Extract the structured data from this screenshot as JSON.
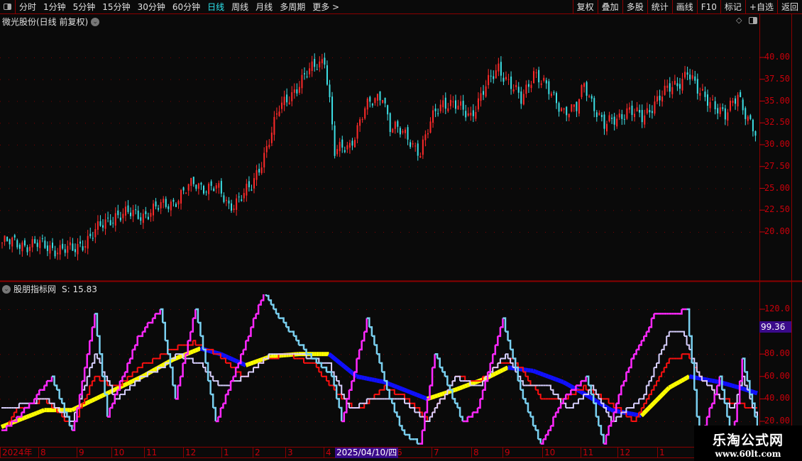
{
  "toolbar": {
    "periods": [
      "分时",
      "1分钟",
      "5分钟",
      "15分钟",
      "30分钟",
      "60分钟",
      "日线",
      "周线",
      "月线",
      "多周期",
      "更多 >"
    ],
    "active_index": 6,
    "right_buttons": [
      "复权",
      "叠加",
      "多股",
      "统计",
      "画线",
      "F10",
      "标记",
      "+自选",
      "返回"
    ]
  },
  "main_title": "微光股份(日线 前复权)",
  "indicator_title": "股朋指标网",
  "indicator_value": "S: 15.83",
  "price_axis": [
    "40.00",
    "37.50",
    "35.00",
    "32.50",
    "30.00",
    "27.50",
    "25.00",
    "22.50",
    "20.00"
  ],
  "indicator_axis": [
    "120.0",
    "80.00",
    "60.00",
    "40.00",
    "20.00"
  ],
  "crosshair_value": "99.36",
  "date_labels": [
    "2024年",
    "8",
    "9",
    "10",
    "11",
    "12",
    "1",
    "2",
    "3",
    "4",
    "6",
    "7",
    "8",
    "9",
    "10",
    "11",
    "12",
    "1"
  ],
  "selected_date": "2025/04/10/四",
  "watermark": {
    "title": "乐淘公式网",
    "url": "www.60lt.com"
  },
  "colors": {
    "up": "#ff2a2a",
    "down": "#3de0e6",
    "magenta": "#ff28ff",
    "cyan": "#7ad0f0",
    "lavender": "#d8d0ff",
    "red": "#ff1010",
    "yellow": "#ffff00",
    "blue": "#1010ff"
  },
  "chart_data": {
    "type": "candlestick+indicator",
    "bars": 300,
    "price_path": [
      [
        0,
        18.8
      ],
      [
        14,
        18.5
      ],
      [
        28,
        17.8
      ],
      [
        37,
        20
      ],
      [
        45,
        22
      ],
      [
        56,
        22
      ],
      [
        68,
        23.5
      ],
      [
        76,
        25.5
      ],
      [
        85,
        25
      ],
      [
        90,
        23
      ],
      [
        99,
        25
      ],
      [
        104,
        29
      ],
      [
        110,
        34
      ],
      [
        115,
        36
      ],
      [
        124,
        39
      ],
      [
        128,
        40
      ],
      [
        130,
        35
      ],
      [
        132,
        29
      ],
      [
        138,
        30
      ],
      [
        144,
        34
      ],
      [
        151,
        36
      ],
      [
        154,
        32
      ],
      [
        161,
        31
      ],
      [
        166,
        29
      ],
      [
        172,
        34
      ],
      [
        175,
        35
      ],
      [
        186,
        33.5
      ],
      [
        197,
        39
      ],
      [
        206,
        35
      ],
      [
        211,
        38.5
      ],
      [
        217,
        36
      ],
      [
        223,
        34
      ],
      [
        228,
        34
      ],
      [
        231,
        37
      ],
      [
        239,
        32
      ],
      [
        248,
        34
      ],
      [
        254,
        33
      ],
      [
        259,
        35
      ],
      [
        268,
        37
      ],
      [
        272,
        38.5
      ],
      [
        276,
        36
      ],
      [
        282,
        35
      ],
      [
        287,
        33
      ],
      [
        292,
        36
      ],
      [
        296,
        33
      ],
      [
        299,
        31
      ]
    ],
    "oscillator": [
      [
        0,
        10
      ],
      [
        11,
        35
      ],
      [
        20,
        60
      ],
      [
        28,
        10
      ],
      [
        37,
        115
      ],
      [
        42,
        25
      ],
      [
        54,
        95
      ],
      [
        63,
        120
      ],
      [
        69,
        40
      ],
      [
        77,
        120
      ],
      [
        85,
        20
      ],
      [
        92,
        60
      ],
      [
        104,
        135
      ],
      [
        111,
        110
      ],
      [
        121,
        80
      ],
      [
        131,
        60
      ],
      [
        135,
        20
      ],
      [
        145,
        110
      ],
      [
        154,
        40
      ],
      [
        159,
        10
      ],
      [
        166,
        0
      ],
      [
        172,
        80
      ],
      [
        183,
        20
      ],
      [
        189,
        30
      ],
      [
        199,
        110
      ],
      [
        207,
        40
      ],
      [
        214,
        0
      ],
      [
        223,
        40
      ],
      [
        232,
        60
      ],
      [
        239,
        0
      ],
      [
        248,
        65
      ],
      [
        259,
        115
      ],
      [
        266,
        115
      ],
      [
        272,
        120
      ],
      [
        277,
        0
      ],
      [
        285,
        60
      ],
      [
        290,
        0
      ],
      [
        294,
        75
      ],
      [
        300,
        15
      ]
    ],
    "red_line": [
      [
        0,
        10
      ],
      [
        6,
        30
      ],
      [
        17,
        40
      ],
      [
        28,
        15
      ],
      [
        37,
        60
      ],
      [
        45,
        50
      ],
      [
        56,
        70
      ],
      [
        68,
        85
      ],
      [
        76,
        90
      ],
      [
        85,
        80
      ],
      [
        96,
        60
      ],
      [
        104,
        75
      ],
      [
        113,
        80
      ],
      [
        124,
        70
      ],
      [
        135,
        40
      ],
      [
        141,
        30
      ],
      [
        152,
        50
      ],
      [
        161,
        40
      ],
      [
        169,
        20
      ],
      [
        180,
        60
      ],
      [
        189,
        55
      ],
      [
        197,
        70
      ],
      [
        203,
        75
      ],
      [
        208,
        60
      ],
      [
        214,
        40
      ],
      [
        223,
        40
      ],
      [
        231,
        50
      ],
      [
        239,
        40
      ],
      [
        245,
        30
      ],
      [
        251,
        20
      ],
      [
        259,
        50
      ],
      [
        265,
        75
      ],
      [
        272,
        80
      ],
      [
        277,
        60
      ],
      [
        285,
        40
      ],
      [
        293,
        35
      ],
      [
        300,
        30
      ]
    ],
    "lavender_line": [
      [
        0,
        30
      ],
      [
        8,
        35
      ],
      [
        17,
        40
      ],
      [
        28,
        20
      ],
      [
        37,
        80
      ],
      [
        45,
        40
      ],
      [
        56,
        60
      ],
      [
        65,
        70
      ],
      [
        69,
        80
      ],
      [
        79,
        70
      ],
      [
        87,
        50
      ],
      [
        96,
        60
      ],
      [
        107,
        80
      ],
      [
        118,
        80
      ],
      [
        130,
        70
      ],
      [
        138,
        30
      ],
      [
        146,
        40
      ],
      [
        158,
        40
      ],
      [
        169,
        20
      ],
      [
        180,
        60
      ],
      [
        189,
        50
      ],
      [
        200,
        80
      ],
      [
        208,
        50
      ],
      [
        217,
        50
      ],
      [
        225,
        30
      ],
      [
        234,
        50
      ],
      [
        242,
        20
      ],
      [
        254,
        40
      ],
      [
        265,
        100
      ],
      [
        270,
        100
      ],
      [
        277,
        60
      ],
      [
        285,
        40
      ],
      [
        290,
        30
      ],
      [
        294,
        60
      ],
      [
        300,
        20
      ]
    ],
    "band": [
      [
        0,
        15
      ],
      [
        17,
        30
      ],
      [
        28,
        30
      ],
      [
        42,
        45
      ],
      [
        56,
        60
      ],
      [
        68,
        75
      ],
      [
        79,
        85
      ],
      [
        87,
        80
      ],
      [
        97,
        70
      ],
      [
        107,
        78
      ],
      [
        118,
        80
      ],
      [
        130,
        80
      ],
      [
        141,
        60
      ],
      [
        152,
        55
      ],
      [
        169,
        40
      ],
      [
        180,
        48
      ],
      [
        192,
        58
      ],
      [
        201,
        68
      ],
      [
        211,
        65
      ],
      [
        223,
        55
      ],
      [
        231,
        45
      ],
      [
        242,
        30
      ],
      [
        254,
        25
      ],
      [
        265,
        50
      ],
      [
        273,
        60
      ],
      [
        285,
        55
      ],
      [
        293,
        50
      ],
      [
        300,
        45
      ]
    ]
  }
}
